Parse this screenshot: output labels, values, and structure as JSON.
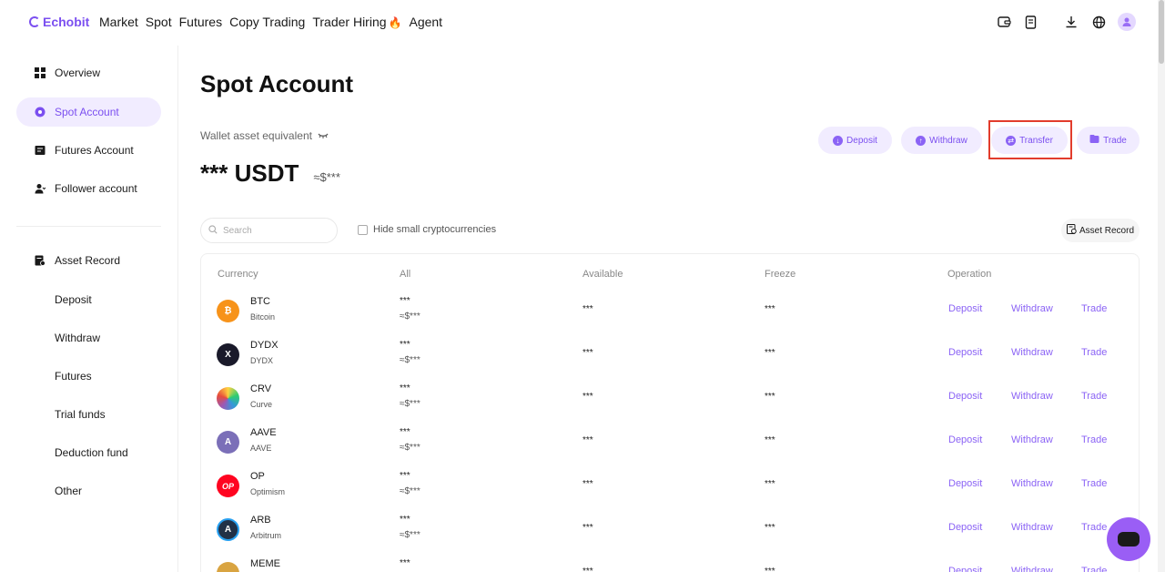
{
  "brand": {
    "name": "Echobit",
    "color": "#7b4ff0"
  },
  "nav": [
    {
      "label": "Market"
    },
    {
      "label": "Spot"
    },
    {
      "label": "Futures"
    },
    {
      "label": "Copy Trading"
    },
    {
      "label": "Trader Hiring"
    },
    {
      "label": "Agent"
    }
  ],
  "top_icons": [
    "wallet-icon",
    "orders-icon",
    "download-icon",
    "globe-icon",
    "user-avatar-icon"
  ],
  "sidebar": {
    "main": [
      {
        "label": "Overview",
        "icon": "grid-icon"
      },
      {
        "label": "Spot Account",
        "icon": "circle-dot-icon",
        "active": true
      },
      {
        "label": "Futures Account",
        "icon": "futures-icon"
      },
      {
        "label": "Follower account",
        "icon": "follower-icon"
      }
    ],
    "record": {
      "label": "Asset Record",
      "icon": "record-icon"
    },
    "sub": [
      "Deposit",
      "Withdraw",
      "Futures",
      "Trial funds",
      "Deduction fund",
      "Other"
    ]
  },
  "main": {
    "title": "Spot Account",
    "wallet_label": "Wallet asset equivalent",
    "balance": "*** USDT",
    "balance_usd": "≈$***",
    "actions": [
      {
        "label": "Deposit",
        "icon": "arrow-down-icon"
      },
      {
        "label": "Withdraw",
        "icon": "arrow-up-icon"
      },
      {
        "label": "Transfer",
        "icon": "transfer-icon"
      },
      {
        "label": "Trade",
        "icon": "trade-icon"
      }
    ],
    "search_placeholder": "Search",
    "hide_small_label": "Hide small cryptocurrencies",
    "asset_record_label": "Asset Record"
  },
  "table": {
    "headers": {
      "currency": "Currency",
      "all": "All",
      "available": "Available",
      "freeze": "Freeze",
      "operation": "Operation"
    },
    "ops": {
      "deposit": "Deposit",
      "withdraw": "Withdraw",
      "trade": "Trade"
    },
    "rows": [
      {
        "symbol": "BTC",
        "name": "Bitcoin",
        "all": "***",
        "all_usd": "≈$***",
        "available": "***",
        "freeze": "***",
        "icon_color": "#f7931a",
        "glyph": "₿"
      },
      {
        "symbol": "DYDX",
        "name": "DYDX",
        "all": "***",
        "all_usd": "≈$***",
        "available": "***",
        "freeze": "***",
        "icon_color": "#1a1a2a",
        "glyph": "X"
      },
      {
        "symbol": "CRV",
        "name": "Curve",
        "all": "***",
        "all_usd": "≈$***",
        "available": "***",
        "freeze": "***",
        "icon_color": "#e5484d",
        "glyph": ""
      },
      {
        "symbol": "AAVE",
        "name": "AAVE",
        "all": "***",
        "all_usd": "≈$***",
        "available": "***",
        "freeze": "***",
        "icon_color": "#7b6fb8",
        "glyph": "A"
      },
      {
        "symbol": "OP",
        "name": "Optimism",
        "all": "***",
        "all_usd": "≈$***",
        "available": "***",
        "freeze": "***",
        "icon_color": "#ff0420",
        "glyph": "OP"
      },
      {
        "symbol": "ARB",
        "name": "Arbitrum",
        "all": "***",
        "all_usd": "≈$***",
        "available": "***",
        "freeze": "***",
        "icon_color": "#213147",
        "glyph": "A"
      },
      {
        "symbol": "MEME",
        "name": "",
        "all": "***",
        "all_usd": "",
        "available": "***",
        "freeze": "***",
        "icon_color": "#d9a441",
        "glyph": ""
      }
    ]
  }
}
